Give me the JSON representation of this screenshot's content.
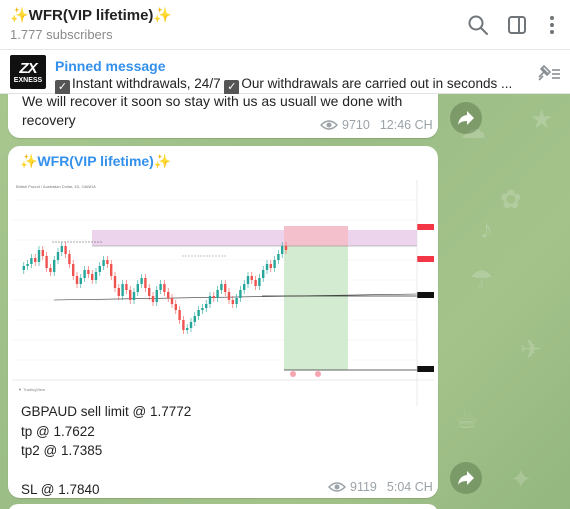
{
  "header": {
    "title": "✨WFR(VIP lifetime)✨",
    "subscribers": "1.777 subscribers"
  },
  "pinned": {
    "thumb_logo": "ZX",
    "thumb_name": "EXNESS",
    "title": "Pinned message",
    "text_part1": "Instant withdrawals, 24/7 ",
    "text_part2": "Our withdrawals are carried out in seconds ..."
  },
  "message1": {
    "text": "We will recover it soon so stay with us as usuall we done with recovery",
    "views": "9710",
    "time": "12:46 CH"
  },
  "message2": {
    "sender": "✨WFR(VIP lifetime)✨",
    "lines": [
      "GBPAUD sell limit @ 1.7772",
      "tp @ 1.7622",
      "tp2 @ 1.7385",
      "",
      "SL @ 1.7840"
    ],
    "views": "9119",
    "time": "5:04 CH"
  },
  "colors": {
    "accent": "#3390ec",
    "meta": "#9ba3a8",
    "bull": "#26a69a",
    "bear": "#ef5350",
    "stop_zone": "#f4c6cf",
    "target_zone": "#cde8cc"
  }
}
